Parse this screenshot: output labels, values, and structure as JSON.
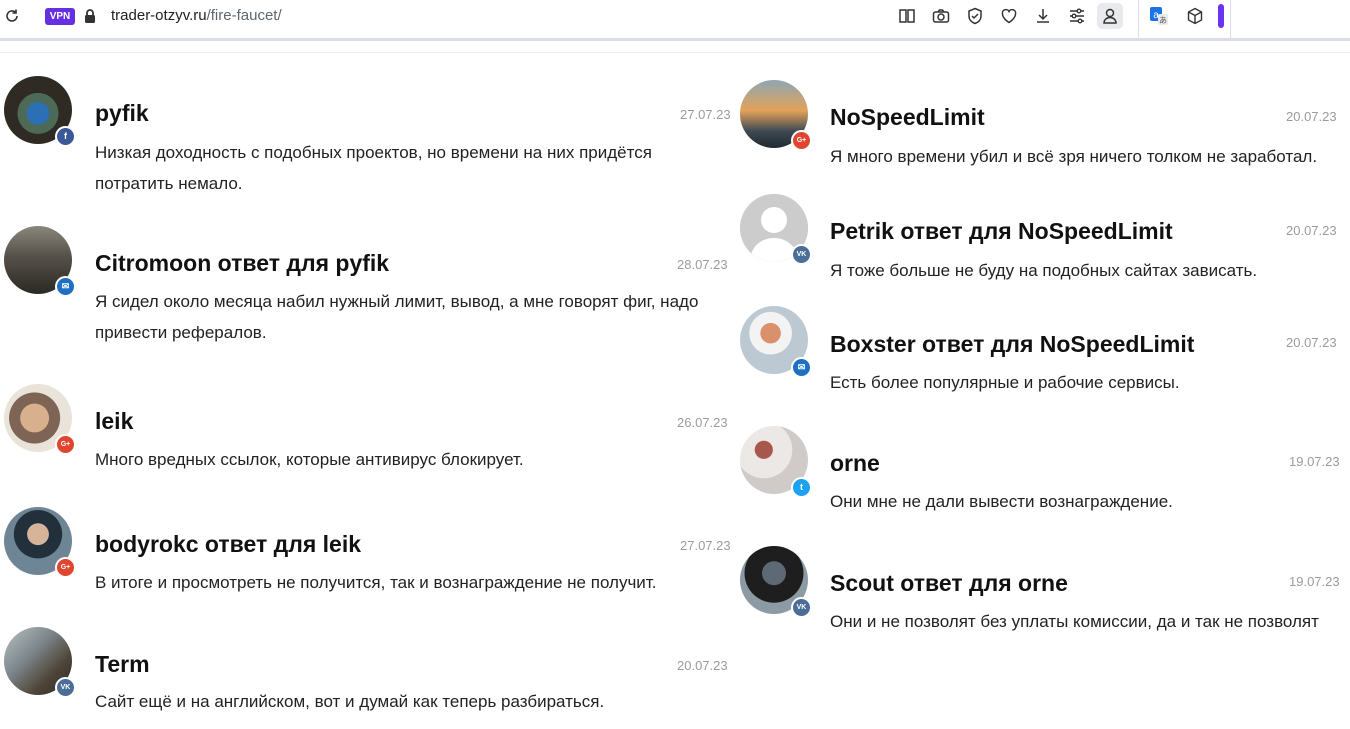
{
  "browser": {
    "url_domain": "trader-otzyv.ru",
    "url_path": "/fire-faucet/",
    "vpn_label": "VPN",
    "toolbar_icons": [
      "reader-view-icon",
      "screenshot-icon",
      "shield-icon",
      "heart-icon",
      "download-icon",
      "sliders-icon",
      "profile-icon",
      "translate-icon",
      "cube-icon"
    ]
  },
  "comments_left": [
    {
      "author": "pyfik",
      "date": "27.07.23",
      "text": "Низкая доходность с подобных проектов, но времени на них придётся потратить немало.",
      "badge": "f",
      "network": "facebook",
      "avatar_colors": [
        "#2b5a8a",
        "#8a6f4e",
        "#2e2e2e"
      ]
    },
    {
      "author": "Citromoon ответ для pyfik",
      "date": "28.07.23",
      "text": "Я сидел около месяца набил нужный лимит, вывод, а мне говорят фиг, надо привести рефералов.",
      "badge": "✉",
      "network": "mail",
      "avatar_colors": [
        "#6b655c",
        "#3b3833",
        "#a9a398"
      ]
    },
    {
      "author": "leik",
      "date": "26.07.23",
      "text": "Много вредных ссылок, которые антивирус блокирует.",
      "badge": "G+",
      "network": "google-plus",
      "avatar_colors": [
        "#c9a587",
        "#8d7363",
        "#efe7dc"
      ]
    },
    {
      "author": "bodyrokc ответ для leik",
      "date": "27.07.23",
      "text": "В итоге и просмотреть не получится, так и вознаграждение не получит.",
      "badge": "G+",
      "network": "google-plus",
      "avatar_colors": [
        "#3a5a7a",
        "#1f2f3e",
        "#7d92a0"
      ]
    },
    {
      "author": "Term",
      "date": "20.07.23",
      "text": "Сайт ещё и на английском, вот и думай как теперь разбираться.",
      "badge": "VK",
      "network": "vk",
      "avatar_colors": [
        "#7e8a8f",
        "#5a5043",
        "#c9cfcf"
      ]
    }
  ],
  "comments_right": [
    {
      "author": "NoSpeedLimit",
      "date": "20.07.23",
      "text": "Я много времени убил и всё зря ничего толком не заработал.",
      "badge": "G+",
      "network": "google-plus",
      "avatar_colors": [
        "#e3a259",
        "#3e4a54",
        "#91a8b6"
      ]
    },
    {
      "author": "Petrik ответ для NoSpeedLimit",
      "date": "20.07.23",
      "text": "Я тоже больше не буду на подобных сайтах зависать.",
      "badge": "VK",
      "network": "vk",
      "avatar_colors": [
        "#c8c8c8",
        "#ffffff",
        "#c8c8c8"
      ]
    },
    {
      "author": "Boxster ответ для NoSpeedLimit",
      "date": "20.07.23",
      "text": "Есть более популярные и рабочие сервисы.",
      "badge": "✉",
      "network": "mail",
      "avatar_colors": [
        "#e8eef3",
        "#c97a55",
        "#f3f3f3"
      ]
    },
    {
      "author": "orne",
      "date": "19.07.23",
      "text": "Они мне не дали вывести вознаграждение.",
      "badge": "t",
      "network": "twitter",
      "avatar_colors": [
        "#d9d4d2",
        "#a8574c",
        "#eeeeee"
      ]
    },
    {
      "author": "Scout ответ для orne",
      "date": "19.07.23",
      "text": "Они и не позволят без уплаты комиссии, да и так не позволят",
      "badge": "VK",
      "network": "vk",
      "avatar_colors": [
        "#2a2a2a",
        "#5d6a75",
        "#9aa7b0"
      ]
    }
  ]
}
